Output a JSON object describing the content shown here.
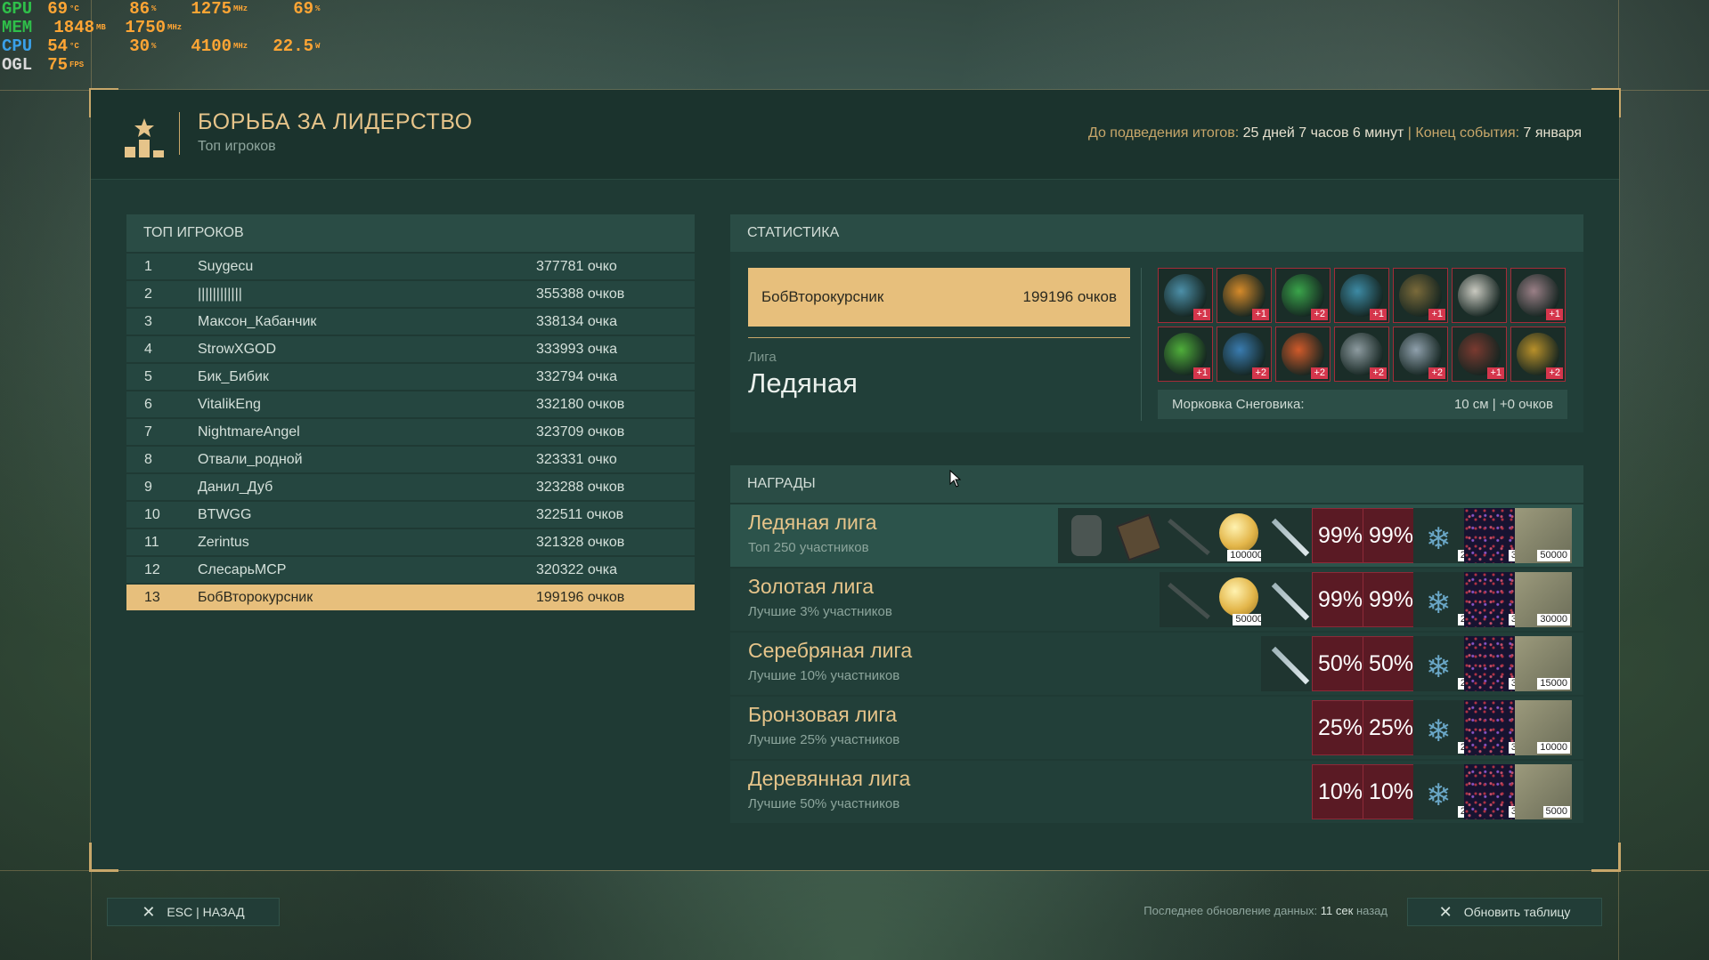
{
  "osd": [
    {
      "label": "GPU",
      "cls": "c-gpu",
      "vals": [
        [
          "69",
          "°C"
        ],
        [
          "86",
          "%"
        ],
        [
          "1275",
          "MHz"
        ],
        [
          "69",
          "%"
        ]
      ]
    },
    {
      "label": "MEM",
      "cls": "c-mem",
      "vals": [
        [
          "1848",
          "MB"
        ],
        [
          "1750",
          "MHz"
        ]
      ]
    },
    {
      "label": "CPU",
      "cls": "c-cpu",
      "vals": [
        [
          "54",
          "°C"
        ],
        [
          "30",
          "%"
        ],
        [
          "4100",
          "MHz"
        ],
        [
          "22.5",
          "W"
        ]
      ]
    },
    {
      "label": "OGL",
      "cls": "c-ogl",
      "vals": [
        [
          "75",
          "FPS"
        ]
      ]
    }
  ],
  "header": {
    "title": "БОРЬБА ЗА ЛИДЕРСТВО",
    "subtitle": "Топ игроков",
    "until_label": "До подведения итогов:",
    "until_value": "25 дней 7 часов 6 минут",
    "sep": "|",
    "end_label": "Конец события:",
    "end_value": "7 января"
  },
  "top_players": {
    "title": "ТОП ИГРОКОВ",
    "rows": [
      {
        "rank": "1",
        "name": "Suygecu",
        "points": "377781 очко"
      },
      {
        "rank": "2",
        "name": "||||||||||||",
        "points": "355388 очков"
      },
      {
        "rank": "3",
        "name": "Максон_Кабанчик",
        "points": "338134 очка"
      },
      {
        "rank": "4",
        "name": "StrowXGOD",
        "points": "333993 очка"
      },
      {
        "rank": "5",
        "name": "Бик_Бибик",
        "points": "332794 очка"
      },
      {
        "rank": "6",
        "name": "VitalikEng",
        "points": "332180 очков"
      },
      {
        "rank": "7",
        "name": "NightmareAngel",
        "points": "323709 очков"
      },
      {
        "rank": "8",
        "name": "Отвали_родной",
        "points": "323331 очко"
      },
      {
        "rank": "9",
        "name": "Данил_Дуб",
        "points": "323288 очков"
      },
      {
        "rank": "10",
        "name": "BTWGG",
        "points": "322511 очков"
      },
      {
        "rank": "11",
        "name": "Zerintus",
        "points": "321328 очков"
      },
      {
        "rank": "12",
        "name": "СлесарьМСР",
        "points": "320322 очка"
      },
      {
        "rank": "13",
        "name": "БобВторокурсник",
        "points": "199196 очков",
        "me": true
      }
    ]
  },
  "stats": {
    "title": "СТАТИСТИКА",
    "player_name": "БобВторокурсник",
    "player_points": "199196 очков",
    "league_label": "Лига",
    "league_value": "Ледяная",
    "items": [
      {
        "color": "#4c8fa8",
        "badge": "+1"
      },
      {
        "color": "#d58a2a",
        "badge": "+1"
      },
      {
        "color": "#3aa44a",
        "badge": "+2"
      },
      {
        "color": "#3d8aa4",
        "badge": "+1"
      },
      {
        "color": "#7a6a3a",
        "badge": "+1"
      },
      {
        "color": "#c9c9c0",
        "badge": ""
      },
      {
        "color": "#9a7f86",
        "badge": "+1"
      },
      {
        "color": "#4fae3a",
        "badge": "+1"
      },
      {
        "color": "#3a7cb0",
        "badge": "+2"
      },
      {
        "color": "#d05a2a",
        "badge": "+2"
      },
      {
        "color": "#8d9ba0",
        "badge": "+2"
      },
      {
        "color": "#8fa0ac",
        "badge": "+2"
      },
      {
        "color": "#7a3a30",
        "badge": "+1"
      },
      {
        "color": "#b8902a",
        "badge": "+2"
      }
    ],
    "carrot_label": "Морковка Снеговика:",
    "carrot_value": "10 см | +0 очков"
  },
  "rewards": {
    "title": "НАГРАДЫ",
    "leagues": [
      {
        "name": "Ледяная лига",
        "desc": "Топ 250 участников",
        "active": true,
        "items": [
          "armor",
          "tablet",
          "rifle",
          "coin:100000",
          "blade",
          "pct:99%",
          "pct:99%",
          "snow:2",
          "stars:3",
          "map:50000"
        ]
      },
      {
        "name": "Золотая лига",
        "desc": "Лучшие 3% участников",
        "items": [
          "rifle",
          "coin:50000",
          "blade",
          "pct:99%",
          "pct:99%",
          "snow:2",
          "stars:3",
          "map:30000"
        ]
      },
      {
        "name": "Серебряная лига",
        "desc": "Лучшие 10% участников",
        "items": [
          "blade",
          "pct:50%",
          "pct:50%",
          "snow:2",
          "stars:3",
          "map:15000"
        ]
      },
      {
        "name": "Бронзовая лига",
        "desc": "Лучшие 25% участников",
        "items": [
          "pct:25%",
          "pct:25%",
          "snow:2",
          "stars:3",
          "map:10000"
        ]
      },
      {
        "name": "Деревянная лига",
        "desc": "Лучшие 50% участников",
        "items": [
          "pct:10%",
          "pct:10%",
          "snow:2",
          "stars:3",
          "map:5000"
        ]
      }
    ]
  },
  "footer": {
    "back_label": "ESC | НАЗАД",
    "update_label": "Последнее обновление данных:",
    "update_value": "11 сек",
    "update_suffix": "назад",
    "refresh_label": "Обновить таблицу"
  },
  "colors": {
    "accent": "#e7bf7c",
    "panel": "#1f3a34",
    "gold_text": "#e6c48a"
  }
}
